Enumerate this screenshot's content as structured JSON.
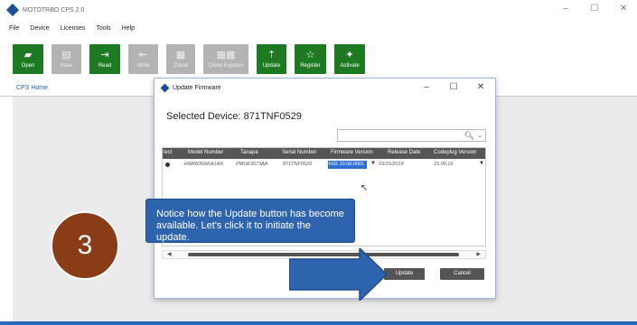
{
  "window": {
    "title": "MOTOTRBO CPS 2.0",
    "controls": [
      "–",
      "☐",
      "✕"
    ]
  },
  "menu": [
    "File",
    "Device",
    "Licenses",
    "Tools",
    "Help"
  ],
  "toolbar": [
    {
      "label": "Open",
      "icon": "folder-icon",
      "glyph": "▰",
      "enabled": true
    },
    {
      "label": "Save",
      "icon": "save-icon",
      "glyph": "▤",
      "enabled": false
    },
    {
      "label": "Read",
      "icon": "read-icon",
      "glyph": "⇥",
      "enabled": true
    },
    {
      "label": "Write",
      "icon": "write-icon",
      "glyph": "⇤",
      "enabled": false
    },
    {
      "label": "Clone",
      "icon": "clone-icon",
      "glyph": "▦",
      "enabled": false
    },
    {
      "label": "Clone Express",
      "icon": "clone-express-icon",
      "glyph": "▦▦",
      "enabled": false
    },
    {
      "label": "Update",
      "icon": "update-icon",
      "glyph": "⇡",
      "enabled": true
    },
    {
      "label": "Register",
      "icon": "star-icon",
      "glyph": "☆",
      "enabled": true
    },
    {
      "label": "Activate",
      "icon": "activate-icon",
      "glyph": "✦",
      "enabled": true
    }
  ],
  "home_tab": "CPS Home",
  "dialog": {
    "title": "Update Firmware",
    "controls": [
      "–",
      "☐",
      "✕"
    ],
    "selected_device": "Selected Device: 871TNF0529",
    "search_placeholder": "",
    "columns": [
      "lect",
      "Model Number",
      "Tanapa",
      "Serial Number",
      "Firmware Version",
      "Release Date",
      "Codeplug Version"
    ],
    "rows": [
      {
        "model": "H98RDN9KA1AN",
        "tanapa": "PMUE3673AA",
        "serial": "871TNF0529",
        "firmware": "R02.10.00.0001",
        "release": "03/31/2019",
        "codeplug": "15.00.16"
      }
    ],
    "update_label": "Update",
    "cancel_label": "Cancel"
  },
  "overlay": {
    "step_number": "3",
    "callout_text": "Notice how the Update button has become available. Let's click it to initiate the update.",
    "colors": {
      "callout": "#2e64ad",
      "step_circle": "#8a3c17",
      "arrow": "#2e64ad"
    }
  },
  "colors": {
    "toolbar_enabled": "#1d7a22",
    "toolbar_disabled": "#b3b3b3",
    "grid_header": "#555555"
  }
}
